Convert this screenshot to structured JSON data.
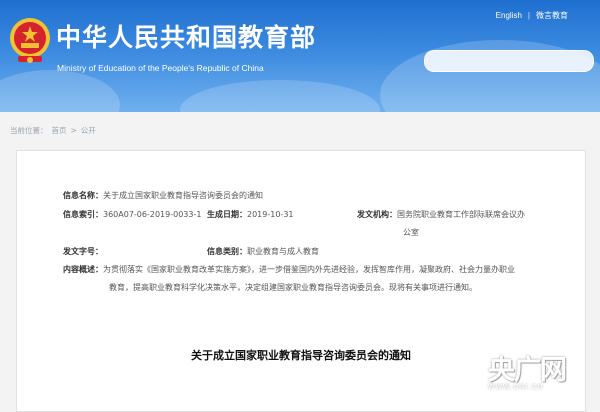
{
  "header": {
    "title_cn": "中华人民共和国教育部",
    "title_en": "Ministry of Education of the People's Republic of China",
    "links": [
      "English",
      "微言教育"
    ],
    "search_placeholder": ""
  },
  "breadcrumb": [
    "当前位置：",
    "首页",
    ">",
    "公开"
  ],
  "info": {
    "title_label": "信息名称：",
    "title_value": "关于成立国家职业教育指导咨询委员会的通知",
    "index_label": "信息索引：",
    "index_value": "360A07-06-2019-0033-1",
    "date_label": "生成日期：",
    "date_value": "2019-10-31",
    "issuer_label": "发文机构：",
    "issuer_value_line1": "国务院职业教育工作部际联席会议办",
    "issuer_value_line2": "公室",
    "docno_label": "发文字号：",
    "docno_value": "",
    "category_label": "信息类别：",
    "category_value": "职业教育与成人教育",
    "summary_label": "内容概述：",
    "summary_line1": "为贯彻落实《国家职业教育改革实施方案》，进一步借鉴国内外先进经验，发挥智库作用，凝聚政府、社会力量办职业",
    "summary_line2": "教育，提高职业教育科学化决策水平，决定组建国家职业教育指导咨询委员会。现将有关事项进行通知。"
  },
  "doc_title": "关于成立国家职业教育指导咨询委员会的通知",
  "watermark": {
    "main": "央广网",
    "sub": "www.cnr.cn"
  },
  "colors": {
    "header_top": "#1f6fd0",
    "header_bottom": "#6fb0ee",
    "emblem_red": "#d4232c",
    "emblem_gold": "#f2c230"
  }
}
